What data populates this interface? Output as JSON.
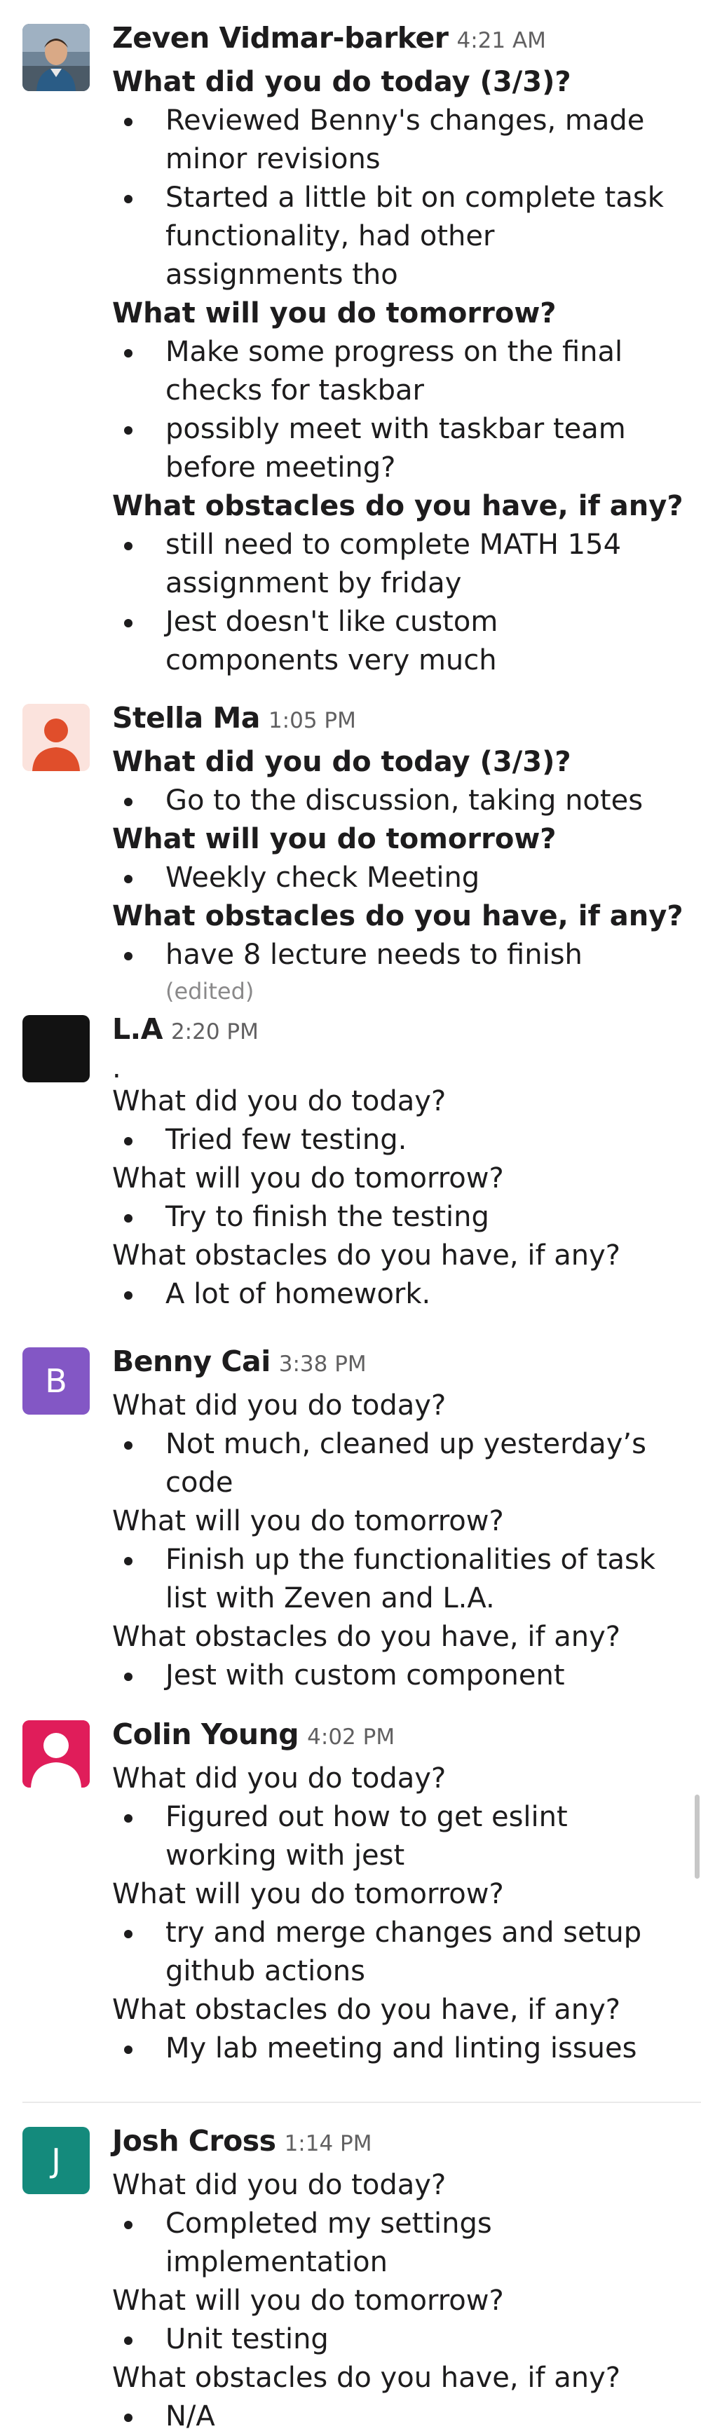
{
  "messages": [
    {
      "author": "Zeven Vidmar-barker",
      "time": "4:21 AM",
      "sections": [
        {
          "q": "What did you do today (3/3)?",
          "items": [
            "Reviewed Benny's changes, made minor revisions",
            "Started a little bit on complete task functionality, had other assignments tho"
          ]
        },
        {
          "q": "What will you do tomorrow?",
          "items": [
            "Make some progress on the final checks for taskbar",
            "possibly meet with taskbar team before meeting?"
          ]
        },
        {
          "q": "What obstacles do you have, if any?",
          "items": [
            "still need to complete MATH 154 assignment by friday",
            "Jest doesn't like custom components very much"
          ]
        }
      ]
    },
    {
      "author": "Stella Ma",
      "time": "1:05 PM",
      "sections": [
        {
          "q": "What did you do today (3/3)?",
          "items": [
            "Go to the discussion, taking notes"
          ]
        },
        {
          "q": "What will you do tomorrow?",
          "items": [
            "Weekly check Meeting"
          ]
        },
        {
          "q": "What obstacles do you have, if any?",
          "items": [
            "have 8 lecture needs to finish"
          ]
        }
      ],
      "edited": "(edited)"
    },
    {
      "author": "L.A",
      "time": "2:20 PM",
      "preamble": ".",
      "sections": [
        {
          "q": "What did you do today?",
          "items": [
            "Tried few testing."
          ]
        },
        {
          "q": "What will you do tomorrow?",
          "items": [
            "Try to finish the testing"
          ]
        },
        {
          "q": "What obstacles do you have, if any?",
          "items": [
            "A lot of homework."
          ]
        }
      ]
    },
    {
      "author": "Benny Cai",
      "time": "3:38 PM",
      "avatar_letter": "B",
      "sections": [
        {
          "q": "What did you do today?",
          "items": [
            "Not much, cleaned up yesterday’s code"
          ]
        },
        {
          "q": "What will you do tomorrow?",
          "items": [
            "Finish up the functionalities of task list with Zeven and L.A."
          ]
        },
        {
          "q": "What obstacles do you have, if any?",
          "items": [
            "Jest with custom component"
          ]
        }
      ]
    },
    {
      "author": "Colin Young",
      "time": "4:02 PM",
      "sections": [
        {
          "q": "What did you do today?",
          "items": [
            "Figured out how to get eslint working with jest"
          ]
        },
        {
          "q": "What will you do tomorrow?",
          "items": [
            "try and merge changes and setup github actions"
          ]
        },
        {
          "q": "What obstacles do you have, if any?",
          "items": [
            "My lab meeting and linting issues"
          ]
        }
      ]
    },
    {
      "author": "Josh Cross",
      "time": "1:14 PM",
      "avatar_letter": "J",
      "sections": [
        {
          "q": "What did you do today?",
          "items": [
            "Completed my settings implementation"
          ]
        },
        {
          "q": "What will you do tomorrow?",
          "items": [
            "Unit testing"
          ]
        },
        {
          "q": "What obstacles do you have, if any?",
          "items": [
            "N/A"
          ]
        }
      ]
    }
  ],
  "colors": {
    "stella_avatar_bg": "#fbe3dd",
    "stella_avatar_fg": "#e04e2b",
    "la_avatar": "#121212",
    "benny_avatar": "#8357c5",
    "colin_avatar_bg": "#e01d5a",
    "josh_avatar": "#148a7c"
  },
  "icons": {
    "zeven_avatar": "profile-photo",
    "stella_avatar": "default-person-icon",
    "colin_avatar": "default-person-icon"
  }
}
